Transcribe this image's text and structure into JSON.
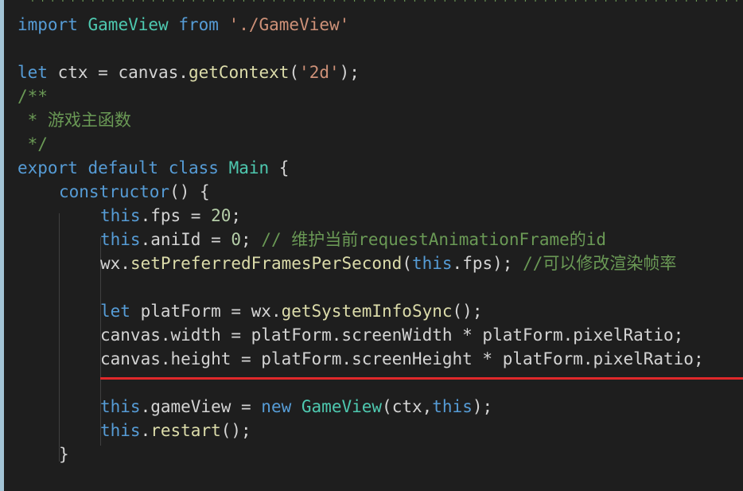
{
  "editor": {
    "lines": [
      {
        "id": "l0",
        "tokens": [
          {
            "c": "stars",
            "t": " **************************************************************************"
          }
        ]
      },
      {
        "id": "l1",
        "tokens": [
          {
            "c": "kw",
            "t": "import"
          },
          {
            "c": "var",
            "t": " "
          },
          {
            "c": "cls",
            "t": "GameView"
          },
          {
            "c": "var",
            "t": " "
          },
          {
            "c": "kw",
            "t": "from"
          },
          {
            "c": "var",
            "t": " "
          },
          {
            "c": "str",
            "t": "'./GameView'"
          }
        ]
      },
      {
        "id": "l2",
        "tokens": []
      },
      {
        "id": "l3",
        "tokens": [
          {
            "c": "kw",
            "t": "let"
          },
          {
            "c": "var",
            "t": " ctx = canvas."
          },
          {
            "c": "fn",
            "t": "getContext"
          },
          {
            "c": "var",
            "t": "("
          },
          {
            "c": "str",
            "t": "'2d'"
          },
          {
            "c": "var",
            "t": ");"
          }
        ]
      },
      {
        "id": "l4",
        "tokens": [
          {
            "c": "cmt",
            "t": "/**"
          }
        ]
      },
      {
        "id": "l5",
        "tokens": [
          {
            "c": "cmt",
            "t": " * 游戏主函数"
          }
        ]
      },
      {
        "id": "l6",
        "tokens": [
          {
            "c": "cmt",
            "t": " */"
          }
        ]
      },
      {
        "id": "l7",
        "tokens": [
          {
            "c": "kw",
            "t": "export"
          },
          {
            "c": "var",
            "t": " "
          },
          {
            "c": "kw",
            "t": "default"
          },
          {
            "c": "var",
            "t": " "
          },
          {
            "c": "kw",
            "t": "class"
          },
          {
            "c": "var",
            "t": " "
          },
          {
            "c": "cls",
            "t": "Main"
          },
          {
            "c": "var",
            "t": " {"
          }
        ]
      },
      {
        "id": "l8",
        "indent": 1,
        "tokens": [
          {
            "c": "kw",
            "t": "constructor"
          },
          {
            "c": "var",
            "t": "() {"
          }
        ]
      },
      {
        "id": "l9",
        "indent": 2,
        "tokens": [
          {
            "c": "kw",
            "t": "this"
          },
          {
            "c": "var",
            "t": ".fps = "
          },
          {
            "c": "num",
            "t": "20"
          },
          {
            "c": "var",
            "t": ";"
          }
        ]
      },
      {
        "id": "l10",
        "indent": 2,
        "tokens": [
          {
            "c": "kw",
            "t": "this"
          },
          {
            "c": "var",
            "t": ".aniId = "
          },
          {
            "c": "num",
            "t": "0"
          },
          {
            "c": "var",
            "t": "; "
          },
          {
            "c": "cmt",
            "t": "// 维护当前requestAnimationFrame的id"
          }
        ]
      },
      {
        "id": "l11",
        "indent": 2,
        "tokens": [
          {
            "c": "var",
            "t": "wx."
          },
          {
            "c": "fn",
            "t": "setPreferredFramesPerSecond"
          },
          {
            "c": "var",
            "t": "("
          },
          {
            "c": "kw",
            "t": "this"
          },
          {
            "c": "var",
            "t": ".fps); "
          },
          {
            "c": "cmt",
            "t": "//可以修改渲染帧率"
          }
        ]
      },
      {
        "id": "l12",
        "tokens": []
      },
      {
        "id": "l13",
        "indent": 2,
        "tokens": [
          {
            "c": "kw",
            "t": "let"
          },
          {
            "c": "var",
            "t": " platForm = wx."
          },
          {
            "c": "fn",
            "t": "getSystemInfoSync"
          },
          {
            "c": "var",
            "t": "();"
          }
        ]
      },
      {
        "id": "l14",
        "indent": 2,
        "tokens": [
          {
            "c": "var",
            "t": "canvas.width = platForm.screenWidth * platForm.pixelRatio;"
          }
        ]
      },
      {
        "id": "l15",
        "indent": 2,
        "tokens": [
          {
            "c": "var",
            "t": "canvas.height = platForm.screenHeight * platForm.pixelRatio;"
          }
        ]
      },
      {
        "id": "l16",
        "tokens": []
      },
      {
        "id": "l17",
        "indent": 2,
        "tokens": [
          {
            "c": "kw",
            "t": "this"
          },
          {
            "c": "var",
            "t": ".gameView = "
          },
          {
            "c": "kw",
            "t": "new"
          },
          {
            "c": "var",
            "t": " "
          },
          {
            "c": "cls",
            "t": "GameView"
          },
          {
            "c": "var",
            "t": "(ctx,"
          },
          {
            "c": "kw",
            "t": "this"
          },
          {
            "c": "var",
            "t": ");"
          }
        ]
      },
      {
        "id": "l18",
        "indent": 2,
        "tokens": [
          {
            "c": "kw",
            "t": "this"
          },
          {
            "c": "var",
            "t": "."
          },
          {
            "c": "fn",
            "t": "restart"
          },
          {
            "c": "var",
            "t": "();"
          }
        ]
      },
      {
        "id": "l19",
        "indent": 1,
        "tokens": [
          {
            "c": "var",
            "t": "}"
          }
        ]
      }
    ],
    "highlight_line": "l15",
    "colors": {
      "background": "#1e1e1e",
      "keyword": "#569cd6",
      "string": "#ce9178",
      "number": "#b5cea8",
      "class": "#4ec9b0",
      "function": "#dcdcaa",
      "comment": "#6a9955",
      "underline": "#e0282a"
    }
  }
}
